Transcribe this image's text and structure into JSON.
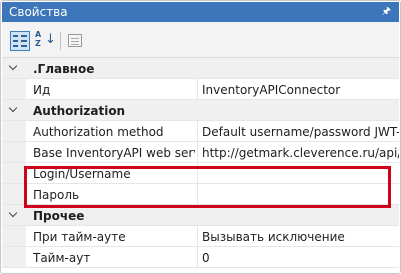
{
  "panel": {
    "title": "Свойства",
    "pin_glyph": "🖈"
  },
  "toolbar": {
    "buttons": [
      {
        "name": "categorized-view",
        "icon": "categorized-icon",
        "active": true
      },
      {
        "name": "alphabetical-sort",
        "icon": "sort-az-icon",
        "active": false
      },
      {
        "name": "property-pages",
        "icon": "property-pages-icon",
        "active": false
      }
    ],
    "sort_a": "A",
    "sort_z": "Z",
    "sort_arrow": "↓"
  },
  "categories": [
    {
      "label": ".Главное",
      "rows": [
        {
          "name": "Ид",
          "value": "InventoryAPIConnector"
        }
      ]
    },
    {
      "label": "Authorization",
      "rows": [
        {
          "name": "Authorization method",
          "value": "Default username/password JWT-"
        },
        {
          "name": "Base InventoryAPI web servi",
          "value": "http://getmark.cleverence.ru/api/v"
        },
        {
          "name": "Login/Username",
          "value": ""
        },
        {
          "name": "Пароль",
          "value": ""
        }
      ]
    },
    {
      "label": "Прочее",
      "rows": [
        {
          "name": "При тайм-ауте",
          "value": "Вызывать исключение"
        },
        {
          "name": "Тайм-аут",
          "value": "0"
        }
      ]
    }
  ],
  "colors": {
    "titlebar": "#3c75b9",
    "highlight": "#d0021b",
    "gutter": "#f0f0f0"
  }
}
